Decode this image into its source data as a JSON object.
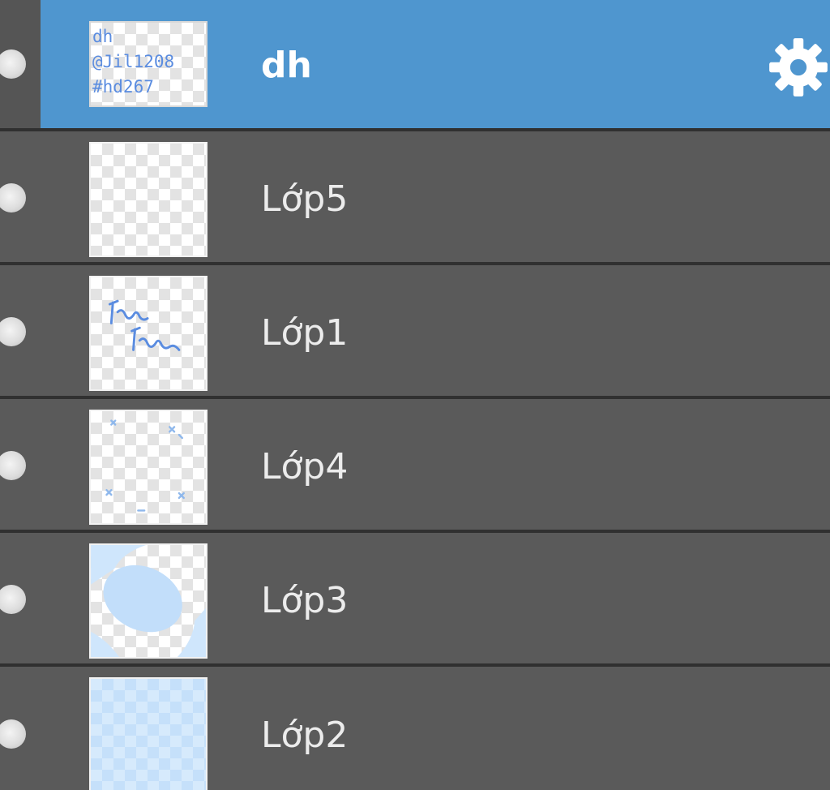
{
  "layers": [
    {
      "name": "dh",
      "selected": true,
      "thumbnail": "text-thumbnail",
      "thumbnail_text": "dh\n@Jil1208\n#hd267",
      "has_settings": true
    },
    {
      "name": "Lớp5",
      "selected": false,
      "thumbnail": "transparent-thumbnail"
    },
    {
      "name": "Lớp1",
      "selected": false,
      "thumbnail": "handwriting-thumbnail"
    },
    {
      "name": "Lớp4",
      "selected": false,
      "thumbnail": "corner-marks-thumbnail"
    },
    {
      "name": "Lớp3",
      "selected": false,
      "thumbnail": "blue-blob-thumbnail"
    },
    {
      "name": "Lớp2",
      "selected": false,
      "thumbnail": "light-blue-fill-thumbnail"
    }
  ],
  "icons": {
    "visibility": "visibility-icon",
    "settings": "gear-icon"
  },
  "colors": {
    "panel_background": "#5a5a5a",
    "selected_row": "#4f96cf",
    "divider": "#303030",
    "layer_text": "#ececec",
    "thumbnail_accent": "#5a8ce0",
    "thumbnail_light_blue": "#c9e3fb"
  }
}
